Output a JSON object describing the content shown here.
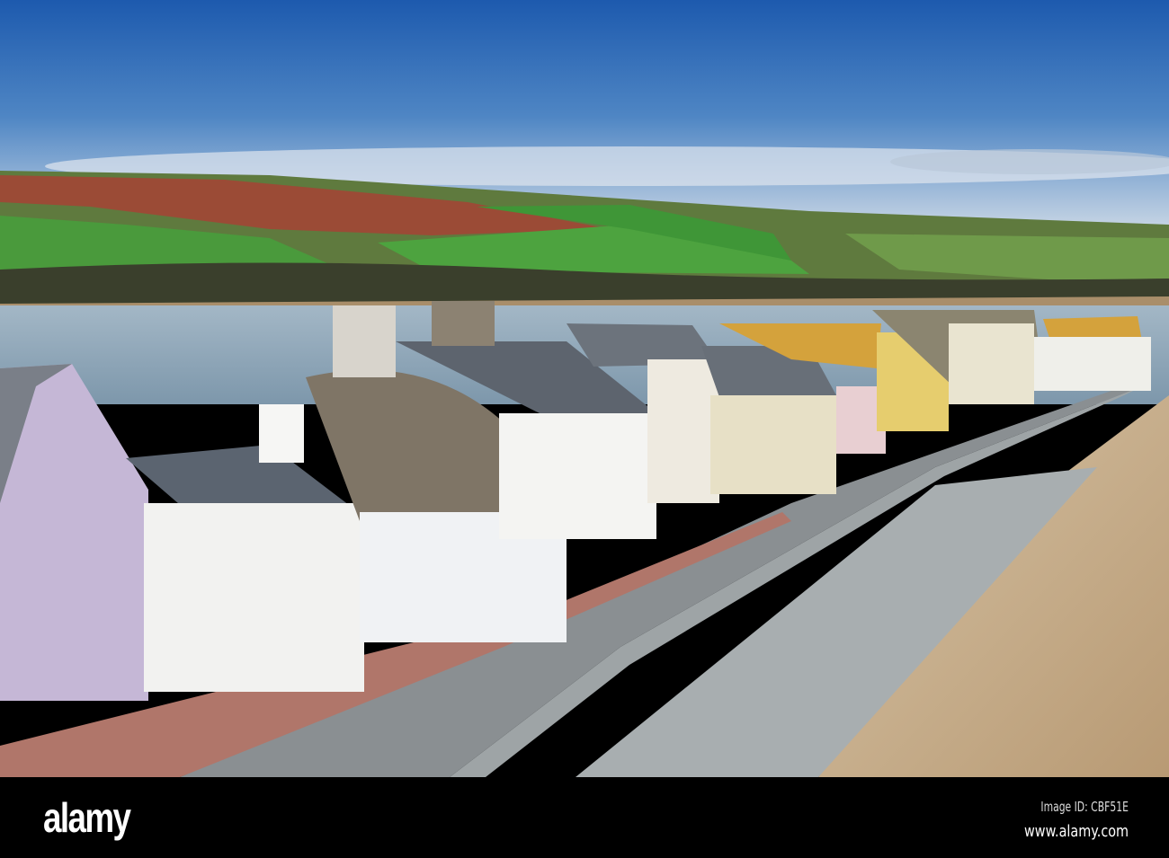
{
  "footer": {
    "logo": "alamy",
    "image_id": "Image ID: CBF51E",
    "website": "www.alamy.com"
  },
  "colors": {
    "sky_top": "#1d5aae",
    "sky_horizon": "#cdd9e6",
    "water": "#8ea5b8",
    "sand": "#c9b08e"
  }
}
